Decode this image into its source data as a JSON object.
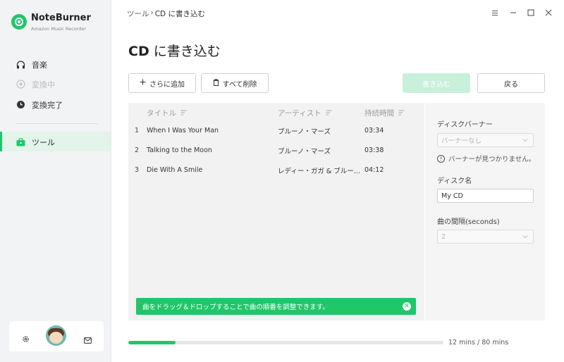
{
  "app": {
    "name": "NoteBurner",
    "subtitle": "Amazon Music Recorder"
  },
  "sidebar": {
    "items": [
      {
        "label": "音楽",
        "icon": "headphones-icon",
        "state": "normal"
      },
      {
        "label": "変換中",
        "icon": "converting-icon",
        "state": "disabled"
      },
      {
        "label": "変換完了",
        "icon": "clock-icon",
        "state": "normal"
      },
      {
        "label": "ツール",
        "icon": "toolbox-icon",
        "state": "active"
      }
    ],
    "bottom": {
      "settings_icon": "gear-icon",
      "avatar": "avatar",
      "mail_icon": "mail-icon"
    }
  },
  "header": {
    "breadcrumb_parent": "ツール",
    "breadcrumb_sep": "›",
    "breadcrumb_current": "CD に書き込む",
    "window_controls": [
      "menu-icon",
      "minimize-icon",
      "maximize-icon",
      "close-icon"
    ]
  },
  "page": {
    "title_bold": "CD",
    "title_rest": " に書き込む"
  },
  "toolbar": {
    "add_label": "さらに追加",
    "delete_all_label": "すべて削除",
    "burn_label": "書き込む",
    "back_label": "戻る"
  },
  "table": {
    "headers": {
      "title": "タイトル",
      "artist": "アーティスト",
      "duration": "持続時間"
    },
    "rows": [
      {
        "num": "1",
        "title": "When I Was Your Man",
        "artist": "ブルーノ・マーズ",
        "duration": "03:34"
      },
      {
        "num": "2",
        "title": "Talking to the Moon",
        "artist": "ブルーノ・マーズ",
        "duration": "03:38"
      },
      {
        "num": "3",
        "title": "Die With A Smile",
        "artist": "レディー・ガガ & ブルー...",
        "duration": "04:12"
      }
    ]
  },
  "toast": {
    "message": "曲をドラッグ＆ドロップすることで曲の順番を調整できます。"
  },
  "panel": {
    "banner_label": "ディスクバーナー",
    "banner_value": "バーナーなし",
    "banner_warning": "バーナーが見つかりません。",
    "disc_name_label": "ディスク名",
    "disc_name_value": "My CD",
    "gap_label": "曲の間隔(seconds)",
    "gap_value": "2"
  },
  "progress": {
    "text": "12 mins / 80 mins",
    "fraction": 0.15
  },
  "colors": {
    "accent": "#1fc76a",
    "accent_light": "#c9f0da",
    "active_bg": "#e3f4ea"
  }
}
